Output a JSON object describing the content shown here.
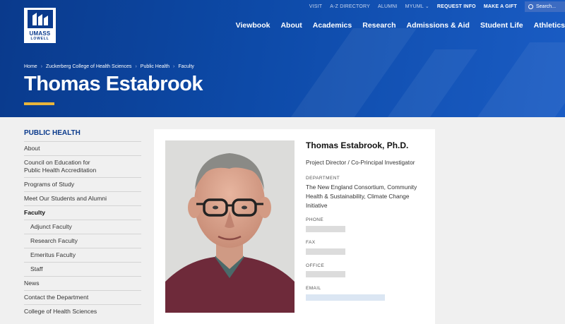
{
  "logo": {
    "line1": "UMASS",
    "line2": "LOWELL"
  },
  "utility_nav": [
    {
      "label": "VISIT",
      "bold": false
    },
    {
      "label": "A-Z DIRECTORY",
      "bold": false
    },
    {
      "label": "ALUMNI",
      "bold": false
    },
    {
      "label": "MYUML ⌄",
      "bold": false
    },
    {
      "label": "REQUEST INFO",
      "bold": true
    },
    {
      "label": "MAKE A GIFT",
      "bold": true
    }
  ],
  "search": {
    "placeholder": "Search..."
  },
  "main_nav": [
    "Viewbook",
    "About",
    "Academics",
    "Research",
    "Admissions & Aid",
    "Student Life",
    "Athletics"
  ],
  "breadcrumb": [
    "Home",
    "Zuckerberg College of Health Sciences",
    "Public Health",
    "Faculty"
  ],
  "page_title": "Thomas Estabrook",
  "sidebar": {
    "heading": "PUBLIC HEALTH",
    "items": [
      {
        "label": "About",
        "sub": false,
        "active": false
      },
      {
        "label": "Council on Education for\nPublic Health Accreditation",
        "sub": false,
        "active": false
      },
      {
        "label": "Programs of Study",
        "sub": false,
        "active": false
      },
      {
        "label": "Meet Our Students and Alumni",
        "sub": false,
        "active": false
      },
      {
        "label": "Faculty",
        "sub": false,
        "active": true
      },
      {
        "label": "Adjunct Faculty",
        "sub": true,
        "active": false
      },
      {
        "label": "Research Faculty",
        "sub": true,
        "active": false
      },
      {
        "label": "Emeritus Faculty",
        "sub": true,
        "active": false
      },
      {
        "label": "Staff",
        "sub": true,
        "active": false
      },
      {
        "label": "News",
        "sub": false,
        "active": false
      },
      {
        "label": "Contact the Department",
        "sub": false,
        "active": false
      },
      {
        "label": "College of Health Sciences",
        "sub": false,
        "active": false
      }
    ]
  },
  "profile": {
    "name": "Thomas Estabrook, Ph.D.",
    "role": "Project Director / Co-Principal Investigator",
    "department_label": "DEPARTMENT",
    "department": "The New England Consortium, Community Health & Sustainability, Climate Change Initiative",
    "phone_label": "PHONE",
    "fax_label": "FAX",
    "office_label": "OFFICE",
    "email_label": "EMAIL"
  },
  "colors": {
    "brand_blue": "#0a3a8c",
    "accent_gold": "#e8b53b"
  }
}
